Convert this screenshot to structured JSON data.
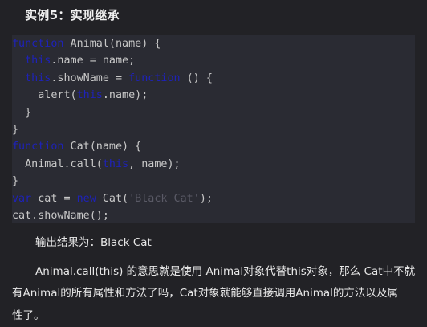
{
  "heading": "实例5：实现继承",
  "code_lines": [
    [
      {
        "t": "function",
        "c": "kw"
      },
      {
        "t": " Animal(name) {",
        "c": ""
      }
    ],
    [
      {
        "t": "  ",
        "c": ""
      },
      {
        "t": "this",
        "c": "kw"
      },
      {
        "t": ".name = name;",
        "c": ""
      }
    ],
    [
      {
        "t": "  ",
        "c": ""
      },
      {
        "t": "this",
        "c": "kw"
      },
      {
        "t": ".showName = ",
        "c": ""
      },
      {
        "t": "function",
        "c": "kw"
      },
      {
        "t": " () {",
        "c": ""
      }
    ],
    [
      {
        "t": "    alert(",
        "c": ""
      },
      {
        "t": "this",
        "c": "kw"
      },
      {
        "t": ".name);",
        "c": ""
      }
    ],
    [
      {
        "t": "  }",
        "c": ""
      }
    ],
    [
      {
        "t": "}",
        "c": ""
      }
    ],
    [
      {
        "t": "function",
        "c": "kw"
      },
      {
        "t": " Cat(name) {",
        "c": ""
      }
    ],
    [
      {
        "t": "  Animal.call(",
        "c": ""
      },
      {
        "t": "this",
        "c": "kw"
      },
      {
        "t": ", name);",
        "c": ""
      }
    ],
    [
      {
        "t": "}",
        "c": ""
      }
    ],
    [
      {
        "t": "var",
        "c": "kw"
      },
      {
        "t": " cat = ",
        "c": ""
      },
      {
        "t": "new",
        "c": "kw"
      },
      {
        "t": " Cat(",
        "c": ""
      },
      {
        "t": "'Black Cat'",
        "c": "str"
      },
      {
        "t": ");",
        "c": ""
      }
    ],
    [
      {
        "t": "cat.showName();",
        "c": ""
      }
    ]
  ],
  "output_label": "输出结果为：Black Cat",
  "explanation_line1": "Animal.call(this) 的意思就是使用 Animal对象代替this对象，那么 Cat中不就",
  "explanation_line2": "有Animal的所有属性和方法了吗，Cat对象就能够直接调用Animal的方法以及属",
  "explanation_line3": "性了。"
}
